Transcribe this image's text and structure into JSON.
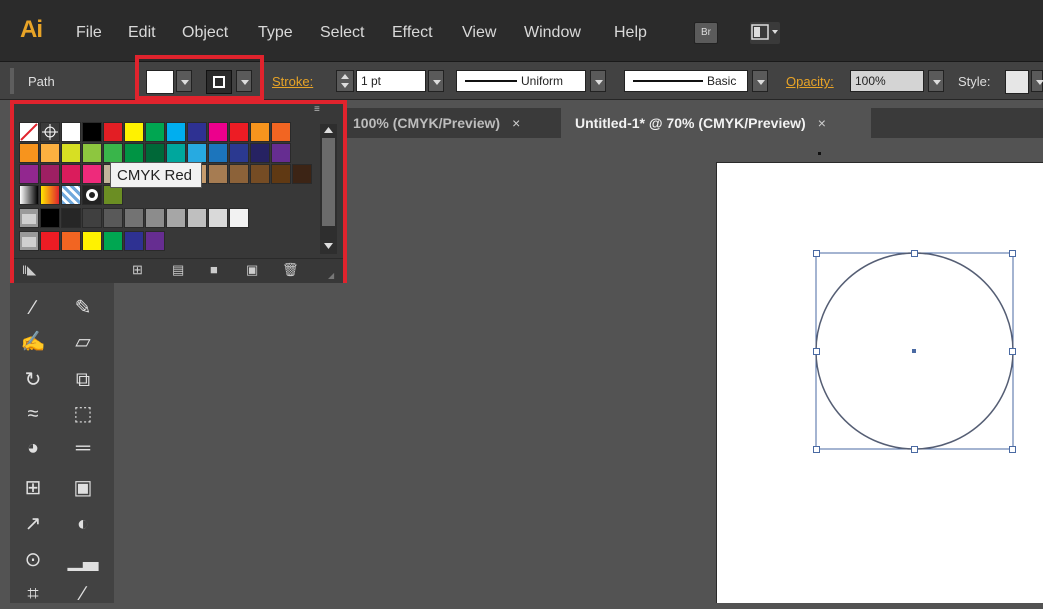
{
  "menubar": {
    "logo": "Ai",
    "items": [
      "File",
      "Edit",
      "Object",
      "Type",
      "Select",
      "Effect",
      "View",
      "Window",
      "Help"
    ],
    "bridge_label": "Br"
  },
  "controlbar": {
    "selection_label": "Path",
    "stroke_label": "Stroke:",
    "stroke_weight": "1 pt",
    "profile_label": "Uniform",
    "brush_label": "Basic",
    "opacity_label": "Opacity:",
    "opacity_value": "100%",
    "style_label": "Style:"
  },
  "swatches": {
    "row1_special": [
      "none-swatch",
      "registration-swatch",
      "white-swatch"
    ],
    "row1_colors": [
      "#000000",
      "#e31e24",
      "#fff200",
      "#00a651",
      "#00aeef",
      "#2e3192",
      "#ec008c",
      "#ed1c24",
      "#f7941d",
      "#f26522"
    ],
    "row2_colors": [
      "#f7941d",
      "#fbb040",
      "#d7df23",
      "#8dc63f",
      "#39b54a",
      "#009444",
      "#006838",
      "#00a79d",
      "#27aae1",
      "#1c75bc",
      "#2b3990",
      "#262262",
      "#662d91"
    ],
    "row3_colors": [
      "#92278f",
      "#9e1f63",
      "#da1c5c",
      "#ee2a7b",
      "#c2b59b",
      "#998675",
      "#736357",
      "#534741",
      "#c69c6d",
      "#a67c52",
      "#8c6239",
      "#754c24",
      "#603913",
      "#3c2415"
    ],
    "row5_grays": [
      "#000000",
      "#262626",
      "#404040",
      "#595959",
      "#737373",
      "#8c8c8c",
      "#a6a6a6",
      "#bfbfbf",
      "#d9d9d9",
      "#f2f2f2"
    ],
    "row6_colors": [
      "#ed1c24",
      "#f26522",
      "#fff200",
      "#00a651",
      "#2e3192",
      "#662d91"
    ],
    "tooltip": "CMYK Red"
  },
  "tabs": [
    {
      "label": "100% (CMYK/Preview)",
      "close": "×"
    },
    {
      "label": "Untitled-1* @ 70% (CMYK/Preview)",
      "close": "×"
    }
  ]
}
